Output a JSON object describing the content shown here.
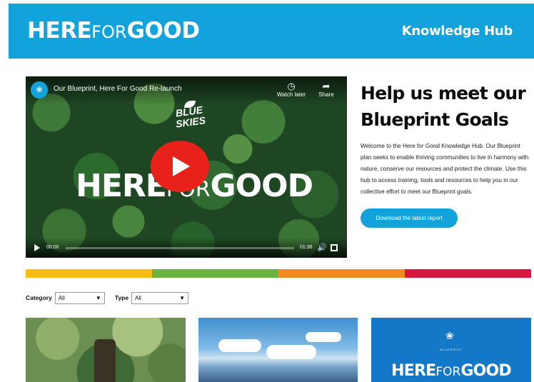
{
  "header": {
    "logo_here": "HERE",
    "logo_for": "FOR",
    "logo_good": "GOOD",
    "nav_link": "Knowledge Hub",
    "bg_color": "#13a3dc"
  },
  "video": {
    "title": "Our Blueprint, Here For Good Re-launch",
    "watch_later": "Watch later",
    "share": "Share",
    "overlay_blue_skies": "BLUE SKIES",
    "overlay_here": "HERE",
    "overlay_for": "FOR",
    "overlay_good": "GOOD",
    "current_time": "00:00",
    "duration": "01:36",
    "progress": 0,
    "play_button_color": "#e8221b"
  },
  "intro": {
    "headline": "Help us meet our Blueprint Goals",
    "body": "Welcome to the Here for Good Knowledge Hub. Our Blueprint plan seeks to enable thriving communities to live in harmony with nature, conserve our resources and protect the climate. Use this hub to access training, tools and resources to help you in our collective effort to meet our Blueprint goals.",
    "button_label": "Download the latest report"
  },
  "strip_colors": [
    "#f7bd12",
    "#6bb144",
    "#f08a24",
    "#d9163f"
  ],
  "filters": {
    "category_label": "Category",
    "category_value": "All",
    "type_label": "Type",
    "type_value": "All"
  },
  "cards": {
    "third_logo_sub": "BLUEPRINT",
    "third_logo_here": "HERE",
    "third_logo_for": "FOR",
    "third_logo_good": "GOOD"
  }
}
